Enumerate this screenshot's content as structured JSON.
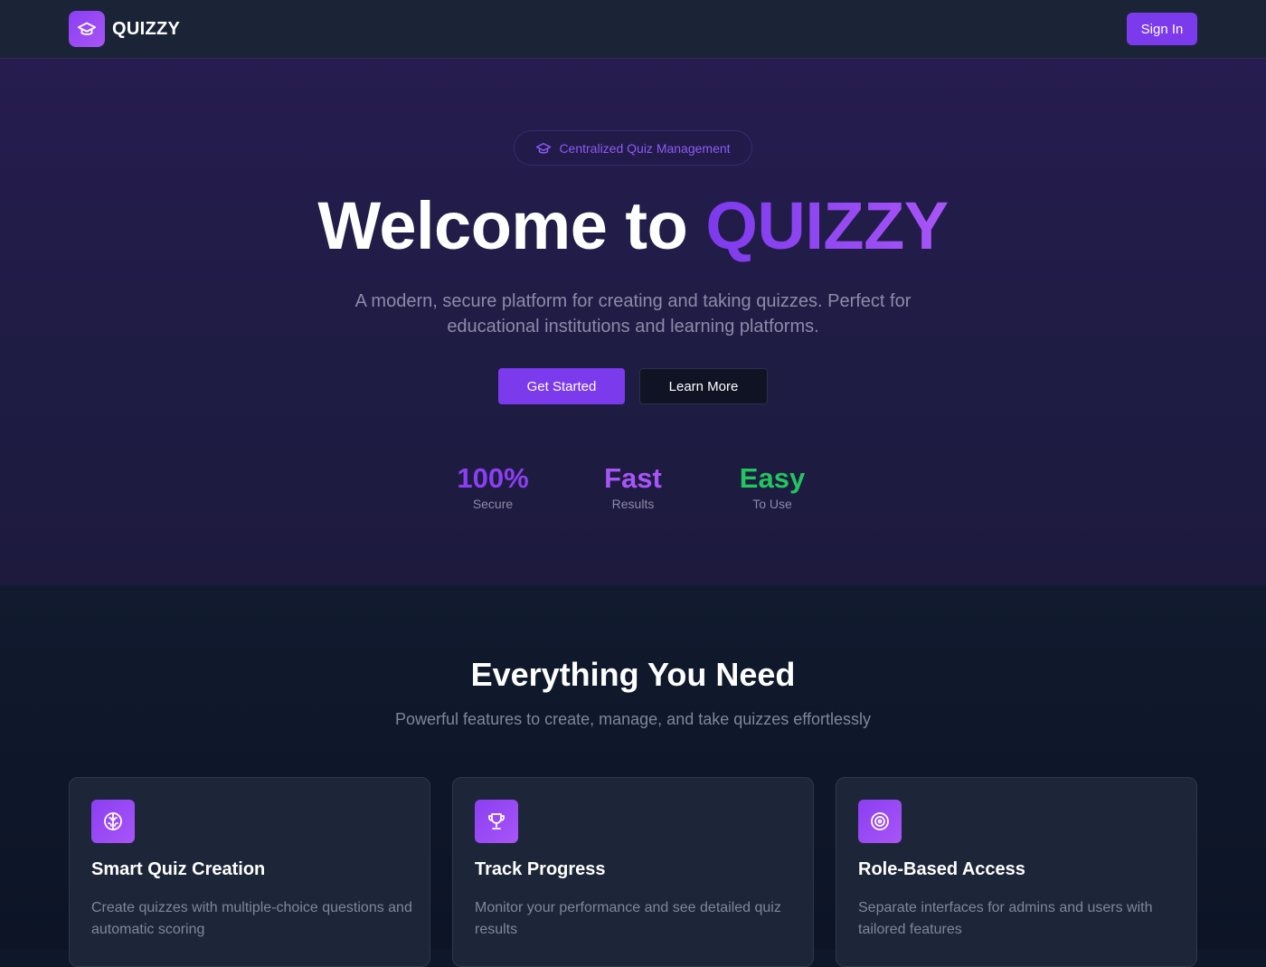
{
  "header": {
    "brand": "QUIZZY",
    "brand_icon": "graduation-cap-icon",
    "signin_label": "Sign In"
  },
  "hero": {
    "pill_icon": "graduation-cap-icon",
    "pill_text": "Centralized Quiz Management",
    "title_prefix": "Welcome to",
    "title_accent": "QUIZZY",
    "subtitle": "A modern, secure platform for creating and taking quizzes. Perfect for educational institutions and learning platforms.",
    "primary_button": "Get Started",
    "secondary_button": "Learn More",
    "stats": [
      {
        "value": "100%",
        "label": "Secure",
        "color": "#8b3ff2"
      },
      {
        "value": "Fast",
        "label": "Results",
        "color": "#a855f7"
      },
      {
        "value": "Easy",
        "label": "To Use",
        "color": "#22c55e"
      }
    ]
  },
  "features": {
    "title": "Everything You Need",
    "subtitle": "Powerful features to create, manage, and take quizzes effortlessly",
    "cards": [
      {
        "icon": "brain-icon",
        "title": "Smart Quiz Creation",
        "description": "Create quizzes with multiple-choice questions and automatic scoring"
      },
      {
        "icon": "trophy-icon",
        "title": "Track Progress",
        "description": "Monitor your performance and see detailed quiz results"
      },
      {
        "icon": "target-icon",
        "title": "Role-Based Access",
        "description": "Separate interfaces for admins and users with tailored features"
      }
    ]
  },
  "colors": {
    "accent": "#7c3aed",
    "accent_light": "#a855f7",
    "green": "#22c55e"
  }
}
